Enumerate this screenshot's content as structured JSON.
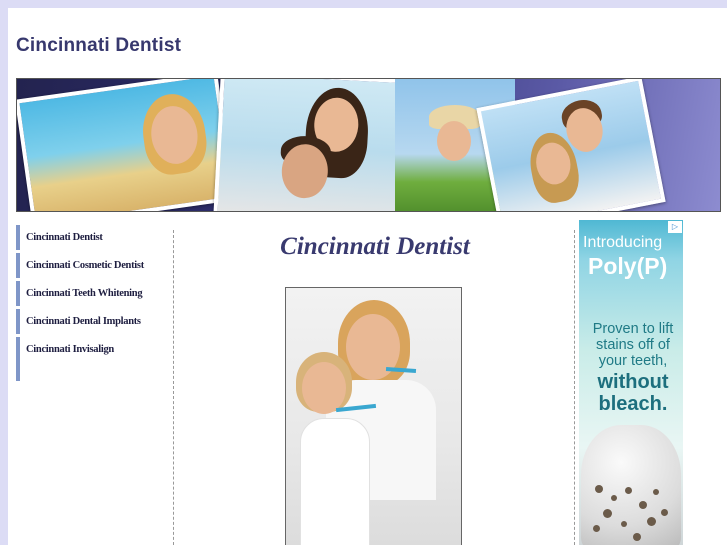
{
  "header": {
    "site_title": "Cincinnati Dentist"
  },
  "sidebar": {
    "items": [
      {
        "label": "Cincinnati Dentist"
      },
      {
        "label": "Cincinnati Cosmetic Dentist"
      },
      {
        "label": "Cincinnati Teeth Whitening"
      },
      {
        "label": "Cincinnati Dental Implants"
      },
      {
        "label": "Cincinnati Invisalign"
      }
    ]
  },
  "main": {
    "heading": "Cincinnati Dentist"
  },
  "ad": {
    "badge": "▷",
    "line1": "Introducing",
    "line2": "Poly(P)",
    "line3": "Proven to lift stains off of your teeth,",
    "line4": "without bleach."
  },
  "colors": {
    "page_background": "#dcdcf5",
    "title": "#37386e",
    "nav_border": "#7f96c8"
  }
}
